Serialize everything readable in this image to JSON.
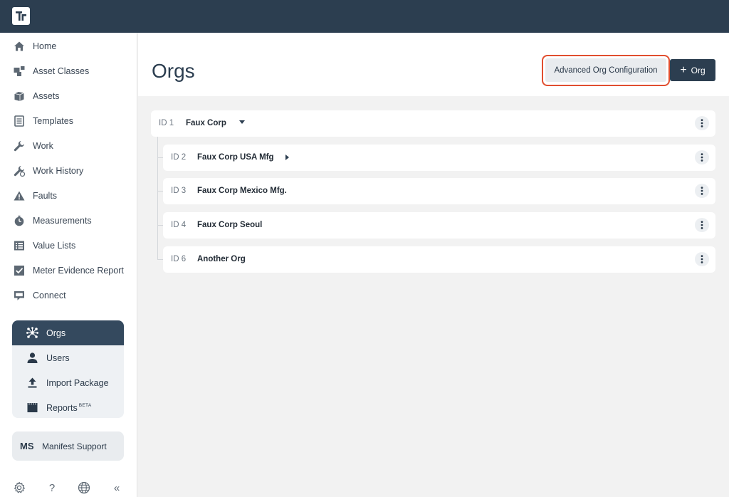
{
  "app": {
    "logo_icon": "tracker-logo-icon"
  },
  "sidebar": {
    "items": [
      {
        "label": "Home",
        "icon": "home-icon"
      },
      {
        "label": "Asset Classes",
        "icon": "asset-classes-icon"
      },
      {
        "label": "Assets",
        "icon": "cube-icon"
      },
      {
        "label": "Templates",
        "icon": "template-icon"
      },
      {
        "label": "Work",
        "icon": "wrench-icon"
      },
      {
        "label": "Work History",
        "icon": "wrench-history-icon"
      },
      {
        "label": "Faults",
        "icon": "warning-icon"
      },
      {
        "label": "Measurements",
        "icon": "stopwatch-icon"
      },
      {
        "label": "Value Lists",
        "icon": "list-icon"
      },
      {
        "label": "Meter Evidence Report",
        "icon": "checkbox-icon"
      },
      {
        "label": "Connect",
        "icon": "chat-icon"
      }
    ],
    "admin_items": [
      {
        "label": "Orgs",
        "icon": "org-network-icon",
        "active": true
      },
      {
        "label": "Users",
        "icon": "user-icon"
      },
      {
        "label": "Import Package",
        "icon": "upload-icon"
      },
      {
        "label": "Reports",
        "icon": "report-icon",
        "badge": "BETA"
      }
    ],
    "user": {
      "initials": "MS",
      "name": "Manifest Support"
    },
    "bottom": {
      "settings": "⚙",
      "help": "?",
      "language": "globe-icon",
      "collapse": "«"
    }
  },
  "header": {
    "title": "Orgs",
    "advanced_button": "Advanced Org Configuration",
    "add_button": "Org",
    "add_button_icon": "+",
    "highlight_color": "#e14e2f"
  },
  "orgs": {
    "root": {
      "id_label": "ID 1",
      "name": "Faux Corp",
      "expanded": true
    },
    "children": [
      {
        "id_label": "ID 2",
        "name": "Faux Corp USA Mfg",
        "has_children": true
      },
      {
        "id_label": "ID 3",
        "name": "Faux Corp Mexico Mfg."
      },
      {
        "id_label": "ID 4",
        "name": "Faux Corp Seoul"
      },
      {
        "id_label": "ID 6",
        "name": "Another Org"
      }
    ]
  },
  "colors": {
    "topbar": "#2c3e50",
    "active_nav": "#34495e",
    "page_bg": "#f2f2f2"
  }
}
